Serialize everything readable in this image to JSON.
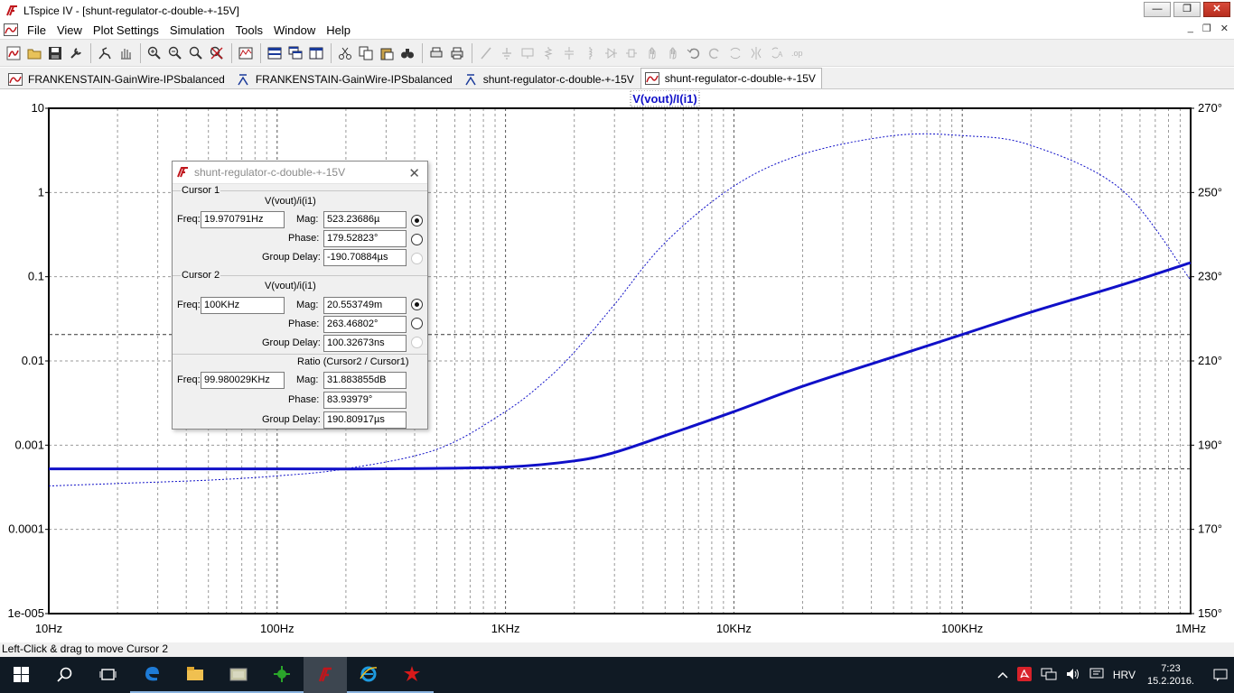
{
  "window": {
    "title": "LTspice IV - [shunt-regulator-c-double-+-15V]",
    "min": "—",
    "max": "❐",
    "close": "✕"
  },
  "menu": [
    "File",
    "View",
    "Plot Settings",
    "Simulation",
    "Tools",
    "Window",
    "Help"
  ],
  "mdi_buttons": [
    "_",
    "❐",
    "✕"
  ],
  "toolbar_icons": [
    "new-schematic-icon",
    "open-icon",
    "save-icon",
    "control-panel-icon",
    "run-icon",
    "halt-icon",
    "zoom-in-icon",
    "zoom-out-icon",
    "zoom-fit-icon",
    "zoom-cancel-icon",
    "autorange-icon",
    "tile-vertical-icon",
    "cascade-icon",
    "tile-horizontal-icon",
    "cut-icon",
    "copy-icon",
    "paste-icon",
    "find-icon",
    "print-preview-icon",
    "print-icon",
    "draw-wire-icon",
    "ground-icon",
    "label-net-icon",
    "resistor-icon",
    "capacitor-icon",
    "inductor-icon",
    "diode-icon",
    "component-icon",
    "move-icon",
    "drag-icon",
    "undo-icon",
    "redo-icon",
    "rotate-icon",
    "mirror-icon",
    "text-icon",
    "spice-directive-icon"
  ],
  "tabs": [
    {
      "label": "FRANKENSTAIN-GainWire-IPSbalanced",
      "icon": "waveform-icon",
      "active": false
    },
    {
      "label": "FRANKENSTAIN-GainWire-IPSbalanced",
      "icon": "schematic-icon",
      "active": false
    },
    {
      "label": "shunt-regulator-c-double-+-15V",
      "icon": "schematic-icon",
      "active": false
    },
    {
      "label": "shunt-regulator-c-double-+-15V",
      "icon": "waveform-icon",
      "active": true
    }
  ],
  "chart_data": {
    "type": "line",
    "title": "V(vout)/I(i1)",
    "x_scale": "log",
    "xlim": [
      10,
      1000000
    ],
    "x_ticks": [
      "10Hz",
      "100Hz",
      "1KHz",
      "10KHz",
      "100KHz",
      "1MHz"
    ],
    "y_scale": "log",
    "ylim": [
      1e-05,
      10
    ],
    "y_ticks": [
      "10",
      "1",
      "0.1",
      "0.01",
      "0.001",
      "0.0001",
      "1e-005"
    ],
    "y2_label_ticks": [
      "270°",
      "250°",
      "230°",
      "210°",
      "190°",
      "170°",
      "150°"
    ],
    "y2lim": [
      150,
      270
    ],
    "grid": true,
    "series": [
      {
        "kind": "magnitude",
        "color": "#1010c8",
        "style": "solid",
        "x": [
          10,
          100,
          300,
          1000,
          2000,
          3000,
          5000,
          10000,
          20000,
          50000,
          100000,
          200000,
          500000,
          1000000
        ],
        "y": [
          0.000523,
          0.000523,
          0.000524,
          0.00055,
          0.00065,
          0.00082,
          0.0013,
          0.0025,
          0.005,
          0.0112,
          0.0206,
          0.038,
          0.08,
          0.147
        ]
      },
      {
        "kind": "phase",
        "color": "#1010c8",
        "style": "dotted",
        "x": [
          10,
          20,
          50,
          100,
          200,
          500,
          1000,
          1500,
          2000,
          3000,
          5000,
          10000,
          20000,
          50000,
          100000,
          200000,
          500000,
          1000000
        ],
        "y": [
          180.3,
          180.9,
          181.7,
          182.7,
          184.4,
          189.0,
          198.0,
          205.4,
          212.1,
          223.4,
          238.1,
          251.5,
          259.1,
          263.5,
          263.5,
          261.2,
          250.6,
          229.2
        ]
      }
    ],
    "cursor_h_lines": [
      {
        "kind": "magnitude",
        "value": 0.000523
      },
      {
        "kind": "magnitude",
        "value": 0.02055
      }
    ]
  },
  "cursor_dialog": {
    "title": "shunt-regulator-c-double-+-15V",
    "cursor1": {
      "group": "Cursor 1",
      "expr": "V(vout)/i(i1)",
      "freq_label": "Freq:",
      "freq": "19.970791Hz",
      "mag_label": "Mag:",
      "mag": "523.23686µ",
      "phase_label": "Phase:",
      "phase": "179.52823°",
      "gd_label": "Group Delay:",
      "gd": "-190.70884µs"
    },
    "cursor2": {
      "group": "Cursor 2",
      "expr": "V(vout)/i(i1)",
      "freq_label": "Freq:",
      "freq": "100KHz",
      "mag_label": "Mag:",
      "mag": "20.553749m",
      "phase_label": "Phase:",
      "phase": "263.46802°",
      "gd_label": "Group Delay:",
      "gd": "100.32673ns"
    },
    "ratio": {
      "group": "Ratio (Cursor2 / Cursor1)",
      "freq_label": "Freq:",
      "freq": "99.980029KHz",
      "mag_label": "Mag:",
      "mag": "31.883855dB",
      "phase_label": "Phase:",
      "phase": "83.93979°",
      "gd_label": "Group Delay:",
      "gd": "190.80917µs"
    }
  },
  "status": "Left-Click & drag to move Cursor 2",
  "taskbar": {
    "items": [
      "start-icon",
      "search-icon",
      "task-view-icon",
      "edge-icon",
      "file-explorer-icon",
      "folder-icon",
      "network-app-icon",
      "ltspice-icon",
      "ie-icon",
      "app-icon"
    ],
    "language": "HRV",
    "time": "7:23",
    "date": "15.2.2016."
  }
}
